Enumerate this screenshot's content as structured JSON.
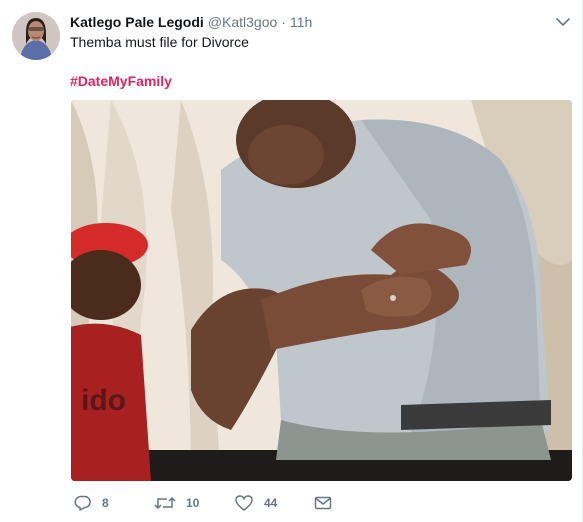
{
  "tweet": {
    "display_name": "Katlego Pale Legodi",
    "handle": "@Katl3goo",
    "separator": "·",
    "time": "11h",
    "text": "Themba must file for Divorce",
    "hashtag": "#DateMyFamily"
  },
  "actions": {
    "reply_count": "8",
    "retweet_count": "10",
    "like_count": "44"
  },
  "icons": {
    "reply": "reply-icon",
    "retweet": "retweet-icon",
    "like": "heart-icon",
    "message": "envelope-icon",
    "more": "chevron-down-icon"
  },
  "colors": {
    "hashtag": "#e0245e",
    "secondary_text": "#657786",
    "primary_text": "#14171a"
  }
}
